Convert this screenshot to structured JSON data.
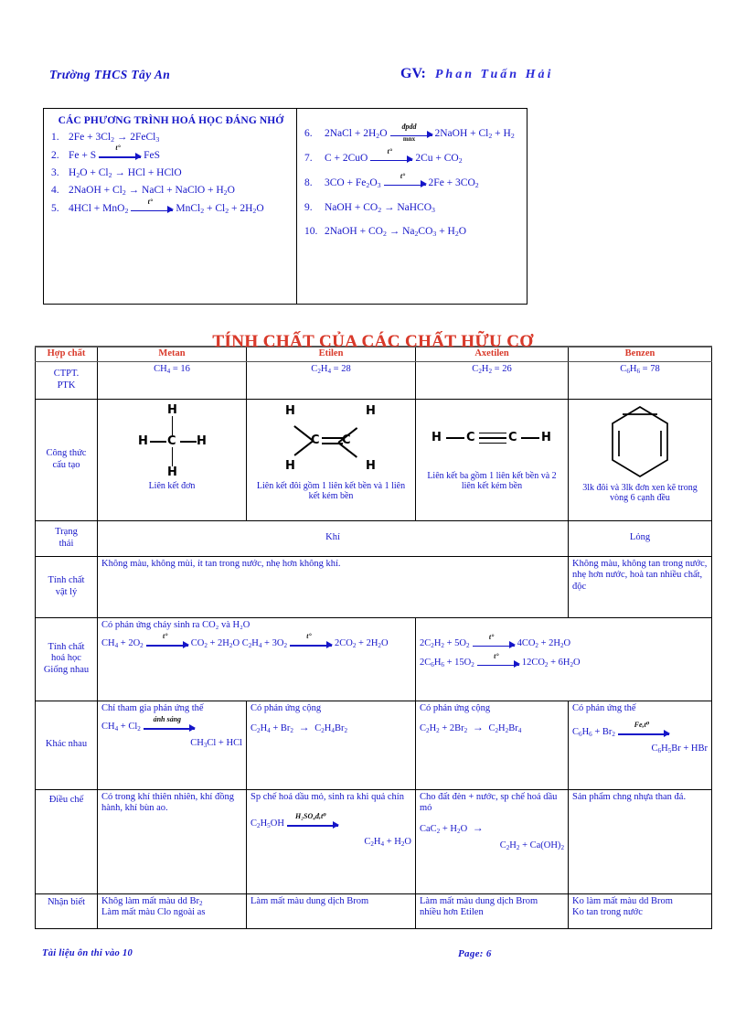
{
  "header": {
    "school": "Trường THCS Tây An",
    "gv_label": "GV:",
    "gv_name": "Phan  Tuấn  Hải"
  },
  "equation_box": {
    "title": "CÁC PHƯƠNG   TRÌNH HOÁ HỌC ĐÁNG NHỚ",
    "left": [
      {
        "num": "1.",
        "text": "2Fe + 3Cl₂ → 2FeCl₃"
      },
      {
        "num": "2.",
        "text": "Fe + S ⟶(t°) FeS"
      },
      {
        "num": "3.",
        "text": "H₂O + Cl₂ → HCl + HClO"
      },
      {
        "num": "4.",
        "text": "2NaOH + Cl₂ → NaCl + NaClO + H₂O"
      },
      {
        "num": "5.",
        "text": "4HCl + MnO₂ ⟶(t°) MnCl₂ + Cl₂ + 2H₂O"
      }
    ],
    "right": [
      {
        "num": "6.",
        "text": "2NaCl + 2H₂O ⟶(đpdd/mnx) 2NaOH + Cl₂ + H₂"
      },
      {
        "num": "7.",
        "text": "C + 2CuO ⟶(t°) 2Cu + CO₂"
      },
      {
        "num": "8.",
        "text": "3CO + Fe₂O₃ ⟶(t°) 2Fe + 3CO₂"
      },
      {
        "num": "9.",
        "text": "NaOH + CO₂ → NaHCO₃"
      },
      {
        "num": "10.",
        "text": "2NaOH + CO₂ → Na₂CO₃ + H₂O"
      }
    ],
    "arrow_labels": {
      "temp": "t°",
      "dpdd": "đpdd",
      "mnx": "mnx"
    }
  },
  "table": {
    "title": "TÍNH CHẤT CỦA CÁC CHẤT HỮU CƠ",
    "title_color": "#d93a2b",
    "headers": [
      "Hợp chất",
      "Metan",
      "Etilen",
      "Axetilen",
      "Benzen"
    ],
    "rows": {
      "ctpt": {
        "label": "CTPT. PTK",
        "metan": "CH₄ = 16",
        "etilen": "C₂H₄ = 28",
        "axetilen": "C₂H₂ = 26",
        "benzen": "C₆H₆ = 78"
      },
      "cautao": {
        "label": "Công thức cấu tạo",
        "metan_caption": "Liên kết đơn",
        "etilen_caption": "Liên kết đôi gồm 1 liên kết bền và 1 liên kết kém bền",
        "axetilen_caption": "Liên kết ba gồm 1 liên kết bền và 2 liên kết kém bền",
        "benzen_caption": "3lk đôi và 3lk đơn xen kẽ trong vòng 6 cạnh đều",
        "diagrams": {
          "metan": "methane-cross-structure",
          "etilen": "ethylene-double-bond-structure",
          "axetilen": "acetylene-triple-bond-structure",
          "benzen": "benzene-hexagon-ring"
        }
      },
      "trangthai": {
        "label": "Trạng thái",
        "khi": "Khí",
        "long": "Lỏng"
      },
      "vatly": {
        "label": "Tính chất vật lý",
        "khi_text": "Không màu, không mùi, ít tan trong nước,  nhẹ hơn không khí.",
        "benzen_text": "Không màu, không tan trong nước,  nhẹ hơn nước,  hoà tan nhiều chất, độc"
      },
      "hoahoc": {
        "label": "Tính chất hoá học Giống nhau",
        "intro": "Có phản ứng cháy sinh ra CO₂ và H₂O",
        "eq1": "CH₄ + 2O₂ ⟶(t°) CO₂ + 2H₂O",
        "eq2": "C₂H₄ + 3O₂ ⟶(t°) 2CO₂ + 2H₂O",
        "eq3": "2C₂H₂ + 5O₂ ⟶(t°) 4CO₂ + 2H₂O",
        "eq4": "2C₆H₆ + 15O₂ ⟶(t°) 12CO₂ + 6H₂O"
      },
      "khacnhau": {
        "label": "Khác nhau",
        "metan_title": "Chỉ tham gia phản ứng thế",
        "metan_eq_left": "CH₄ + Cl₂",
        "metan_eq_label": "ánh sáng",
        "metan_eq_right": "CH₃Cl + HCl",
        "etilen_title": "Có phản ứng cộng",
        "etilen_eq": "C₂H₄ + Br₂ → C₂H₄Br₂",
        "axetilen_title": "Có phản ứng cộng",
        "axetilen_eq": "C₂H₂ + 2Br₂ → C₂H₂Br₄",
        "benzen_title": "Có phản ứng thế",
        "benzen_eq_left": "C₆H₆ + Br₂",
        "benzen_eq_label": "Fe,t⁰",
        "benzen_eq_right": "C₆H₅Br + HBr"
      },
      "dieuche": {
        "label": "Điều chế",
        "metan_text": "Có trong  khí  thiên  nhiên,  khí đồng hành, khí bùn ao.",
        "etilen_text": "Sp chế hoá dầu mỏ, sinh ra khi quả chín",
        "etilen_eq_left": "C₂H₅OH",
        "etilen_eq_label": "H₂SO₄đ,t⁰",
        "etilen_eq_right": "C₂H₄ + H₂O",
        "axetilen_text": "Cho đất đèn + nước,  sp chế hoá dầu mỏ",
        "axetilen_eq_left": "CaC₂ + H₂O →",
        "axetilen_eq_right": "C₂H₂ + Ca(OH)₂",
        "benzen_text": "Sản phẩm chng   nhựa than đá."
      },
      "nhanbiet": {
        "label": "Nhận biết",
        "metan_l1": "Khôg  làm mất màu dd Br₂",
        "metan_l2": "Làm mất màu Clo ngoài as",
        "etilen": "Làm mất màu dung dịch Brom",
        "axetilen_l1": "Làm  mất  màu  dung  dịch Brom",
        "axetilen_l2": "nhiều hơn Etilen",
        "benzen_l1": "Ko làm mất màu dd Brom",
        "benzen_l2": "Ko tan trong nước"
      }
    }
  },
  "footer": {
    "left": "Tài liệu ôn thi vào 10",
    "right": "Page: 6"
  }
}
